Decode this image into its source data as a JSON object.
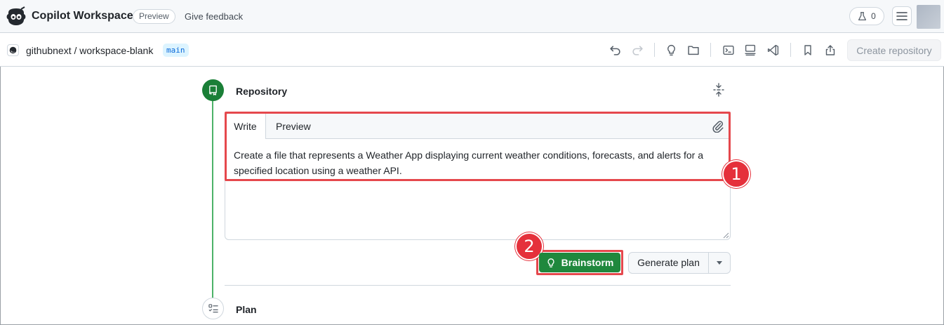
{
  "header": {
    "app_title": "Copilot Workspace",
    "preview_badge": "Preview",
    "feedback_link": "Give feedback",
    "labs_count": "0"
  },
  "repobar": {
    "repo_name": "githubnext / workspace-blank",
    "branch": "main",
    "create_repository": "Create repository",
    "toolbar_icons": [
      "undo-icon",
      "redo-icon",
      "lightbulb-icon",
      "folder-icon",
      "terminal-icon",
      "server-icon",
      "vscode-icon",
      "bookmark-icon",
      "share-icon"
    ]
  },
  "steps": {
    "repository": "Repository",
    "plan": "Plan"
  },
  "editor": {
    "tabs": [
      "Write",
      "Preview"
    ],
    "prompt": "Create a file that represents a Weather App displaying current weather conditions, forecasts, and alerts for a specified location using a weather API."
  },
  "actions": {
    "brainstorm": "Brainstorm",
    "generate_plan": "Generate plan"
  },
  "callouts": [
    "1",
    "2"
  ],
  "colors": {
    "primary_green": "#1f883d",
    "highlight_red": "#e5484d",
    "link_blue": "#0969da"
  }
}
